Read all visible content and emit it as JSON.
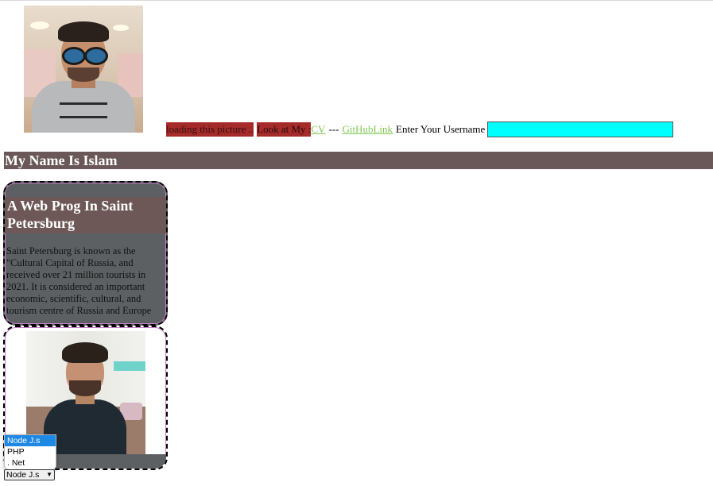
{
  "profile": {
    "alt_text": "loading this picture ..",
    "look_at_label": "Look at My :",
    "cv_link": "CV",
    "separator": "---",
    "github_link": "GitHubLink",
    "username_label": "Enter Your Username",
    "username_value": ""
  },
  "header": {
    "name_title": "My Name Is Islam"
  },
  "card": {
    "heading": "A Web Prog In Saint Petersburg",
    "paragraph": "Saint Petersburg is known as the \"Cultural Capital of Russia, and received over 21 million tourists in 2021. It is considered an important economic, scientific, cultural, and tourism centre of Russia and Europe"
  },
  "tech_select": {
    "selected": "Node J.s",
    "options": [
      "Node J.s",
      "PHP",
      ". Net"
    ]
  },
  "colors": {
    "name_bar": "#6a5757",
    "card_bg": "#5c6062",
    "input_bg": "#00ffff",
    "link": "#7ec850",
    "alt_text_bg": "#a52a2a",
    "dropdown_selected": "#1e88e5"
  }
}
